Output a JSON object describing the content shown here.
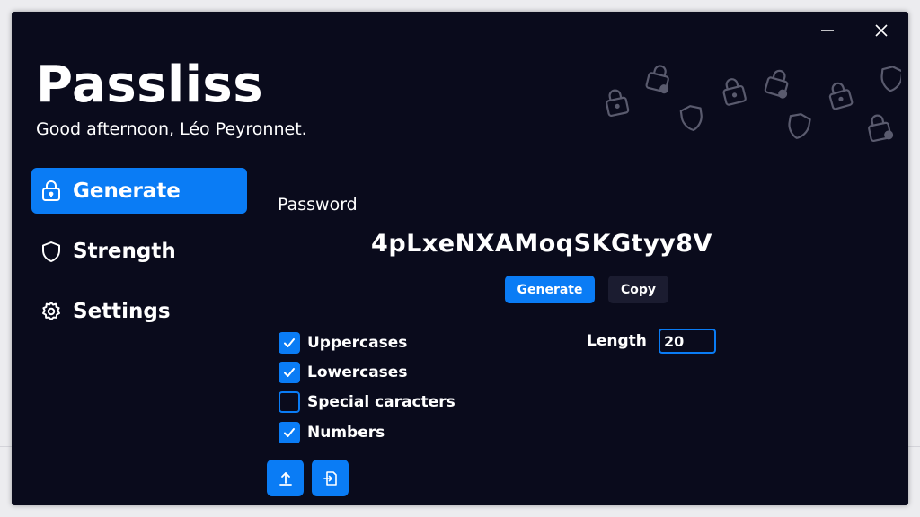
{
  "app": {
    "title": "Passliss",
    "greeting": "Good afternoon, Léo Peyronnet."
  },
  "window_controls": {
    "minimize_icon": "minimize-icon",
    "close_icon": "close-icon"
  },
  "sidebar": {
    "items": [
      {
        "label": "Generate",
        "icon": "lock-icon",
        "active": true
      },
      {
        "label": "Strength",
        "icon": "shield-icon",
        "active": false
      },
      {
        "label": "Settings",
        "icon": "gear-icon",
        "active": false
      }
    ]
  },
  "generator": {
    "password_label": "Password",
    "password_value": "4pLxeNXAMoqSKGtyy8V",
    "generate_label": "Generate",
    "copy_label": "Copy",
    "options": [
      {
        "label": "Uppercases",
        "checked": true
      },
      {
        "label": "Lowercases",
        "checked": true
      },
      {
        "label": "Special caracters",
        "checked": false
      },
      {
        "label": "Numbers",
        "checked": true
      }
    ],
    "length_label": "Length",
    "length_value": "20"
  },
  "bottom_actions": [
    {
      "icon": "export-icon"
    },
    {
      "icon": "import-icon"
    }
  ],
  "colors": {
    "background": "#0a0b1c",
    "accent": "#0a7cf5",
    "secondary_button": "#1b1c30",
    "text": "#ffffff",
    "decoration": "#5a5b6e"
  }
}
